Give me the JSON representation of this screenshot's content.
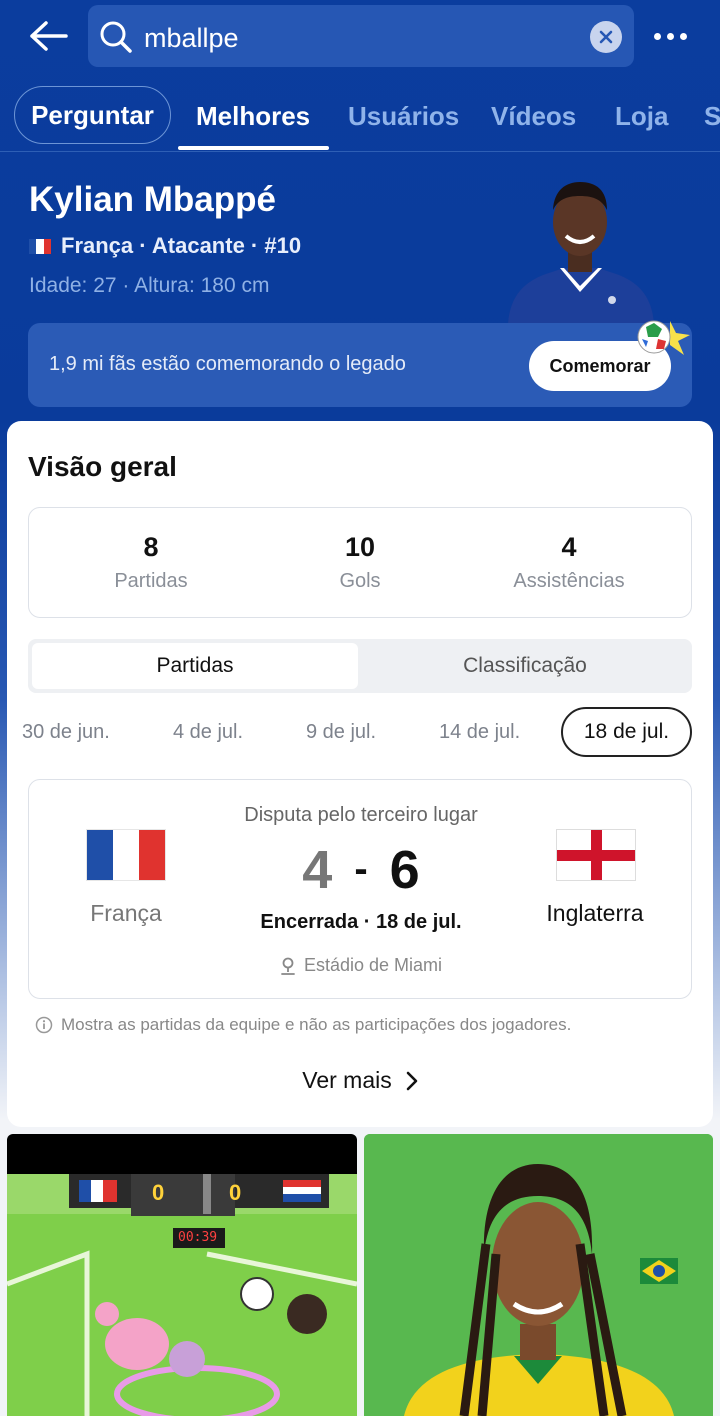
{
  "search": {
    "query": "mballpe"
  },
  "tabs": [
    {
      "label": "Perguntar"
    },
    {
      "label": "Melhores"
    },
    {
      "label": "Usuários"
    },
    {
      "label": "Vídeos"
    },
    {
      "label": "Loja"
    },
    {
      "label": "S"
    }
  ],
  "player": {
    "name": "Kylian Mbappé",
    "meta": "França · Atacante · #10",
    "sub": "Idade: 27 · Altura: 180 cm"
  },
  "fans": {
    "text": "1,9 mi fãs estão comemorando o legado",
    "button": "Comemorar"
  },
  "overview": {
    "title": "Visão geral",
    "stats": [
      {
        "value": "8",
        "label": "Partidas"
      },
      {
        "value": "10",
        "label": "Gols"
      },
      {
        "value": "4",
        "label": "Assistências"
      }
    ],
    "segments": [
      "Partidas",
      "Classificação"
    ],
    "dates": [
      "30 de jun.",
      "4 de jul.",
      "9 de jul.",
      "14 de jul.",
      "18 de jul."
    ],
    "match": {
      "stage": "Disputa pelo terceiro lugar",
      "home": "França",
      "away": "Inglaterra",
      "home_score": "4",
      "separator": "-",
      "away_score": "6",
      "status": "Encerrada · 18 de jul.",
      "venue": "Estádio de Miami"
    },
    "note": "Mostra as partidas da equipe e não as participações dos jogadores.",
    "see_more": "Ver mais"
  },
  "thumb_left": {
    "score_home": "0",
    "score_away": "0",
    "timer": "00:39"
  },
  "colors": {
    "brand_blue": "#0b3d9e",
    "france_blue": "#1f4fa8",
    "france_red": "#e0332f",
    "england_red": "#cf142b"
  }
}
